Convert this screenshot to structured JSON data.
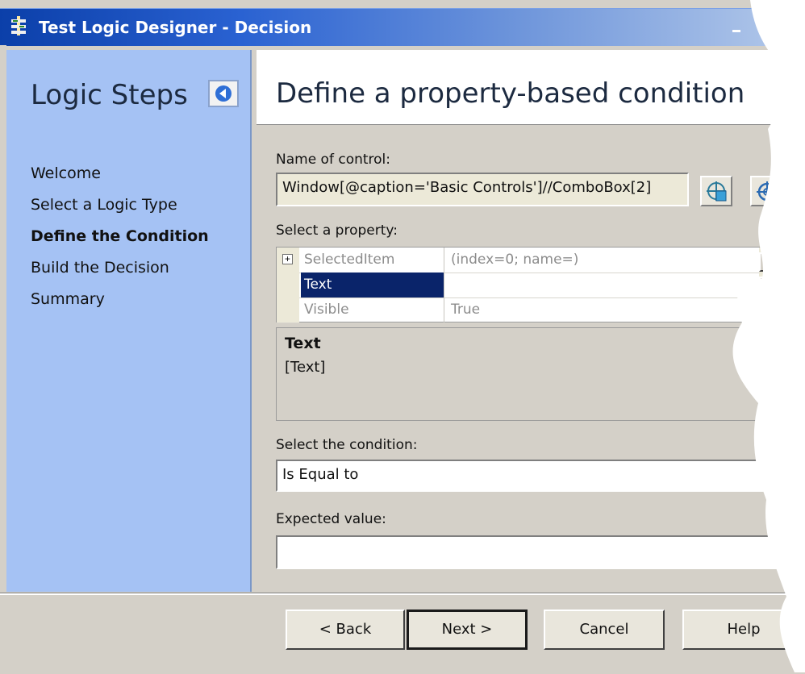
{
  "window": {
    "title": "Test Logic Designer - Decision"
  },
  "sidebar": {
    "heading": "Logic Steps",
    "steps": [
      {
        "label": "Welcome"
      },
      {
        "label": "Select a Logic Type"
      },
      {
        "label": "Define the Condition"
      },
      {
        "label": "Build the Decision"
      },
      {
        "label": "Summary"
      }
    ],
    "active_step": "Define the Condition"
  },
  "main": {
    "title": "Define a property-based condition",
    "control_label": "Name of control:",
    "control_value": "Window[@caption='Basic Controls']//ComboBox[2]",
    "property_label": "Select a property:",
    "properties": [
      {
        "name": "SelectedItem",
        "value": "(index=0; name=)",
        "expandable": true,
        "expander": "+"
      },
      {
        "name": "Text",
        "value": "",
        "selected": true
      },
      {
        "name": "Visible",
        "value": "True"
      }
    ],
    "description": {
      "title": "Text",
      "text": "[Text]"
    },
    "condition_label": "Select the condition:",
    "condition_value": "Is Equal to",
    "expected_label": "Expected value:",
    "expected_value": ""
  },
  "footer": {
    "back_label": "< Back",
    "next_label": "Next >",
    "cancel_label": "Cancel",
    "help_label": "Help"
  },
  "colors": {
    "sidebar_bg": "#a5c2f4",
    "selection": "#0a246a",
    "title_bar": "#2a62d2"
  },
  "icons": {
    "app": "designer-app-icon",
    "collapse": "collapse-left-arrow-icon",
    "pick_control": "control-picker-icon",
    "target": "crosshair-target-icon"
  }
}
